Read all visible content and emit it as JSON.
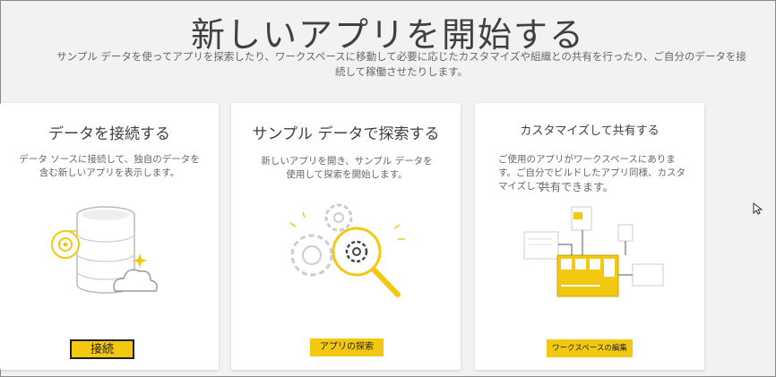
{
  "header": {
    "title": "新しいアプリを開始する",
    "subtitle": "サンプル データを使ってアプリを探索したり、ワークスペースに移動して必要に応じたカスタマイズや組織との共有を行ったり、ご自分のデータを接続して稼働させたりします。"
  },
  "cards": [
    {
      "title": "データを接続する",
      "description": "データ ソースに接続して、独自のデータを含む新しいアプリを表示します。",
      "button": "接続",
      "icons": [
        "database-icon",
        "gear-icon",
        "cloud-icon",
        "sparkle-icon"
      ]
    },
    {
      "title": "サンプル データで探索する",
      "description": "新しいアプリを開き、サンプル データを使用して探索を開始します。",
      "button": "アプリの探索",
      "icons": [
        "gears-icon",
        "magnifier-icon"
      ]
    },
    {
      "title": "カスタマイズして共有する",
      "description_line1": "ご使用のアプリがワークスペースにあります。ご自分でビルドしたアプリ同様、カスタマイズして",
      "description_line2": "共有できます。",
      "button": "ワークスペースの編集",
      "icons": [
        "dashboard-icon"
      ]
    }
  ],
  "colors": {
    "accent": "#f2c811",
    "background": "#f2f2f2",
    "card": "#ffffff"
  }
}
